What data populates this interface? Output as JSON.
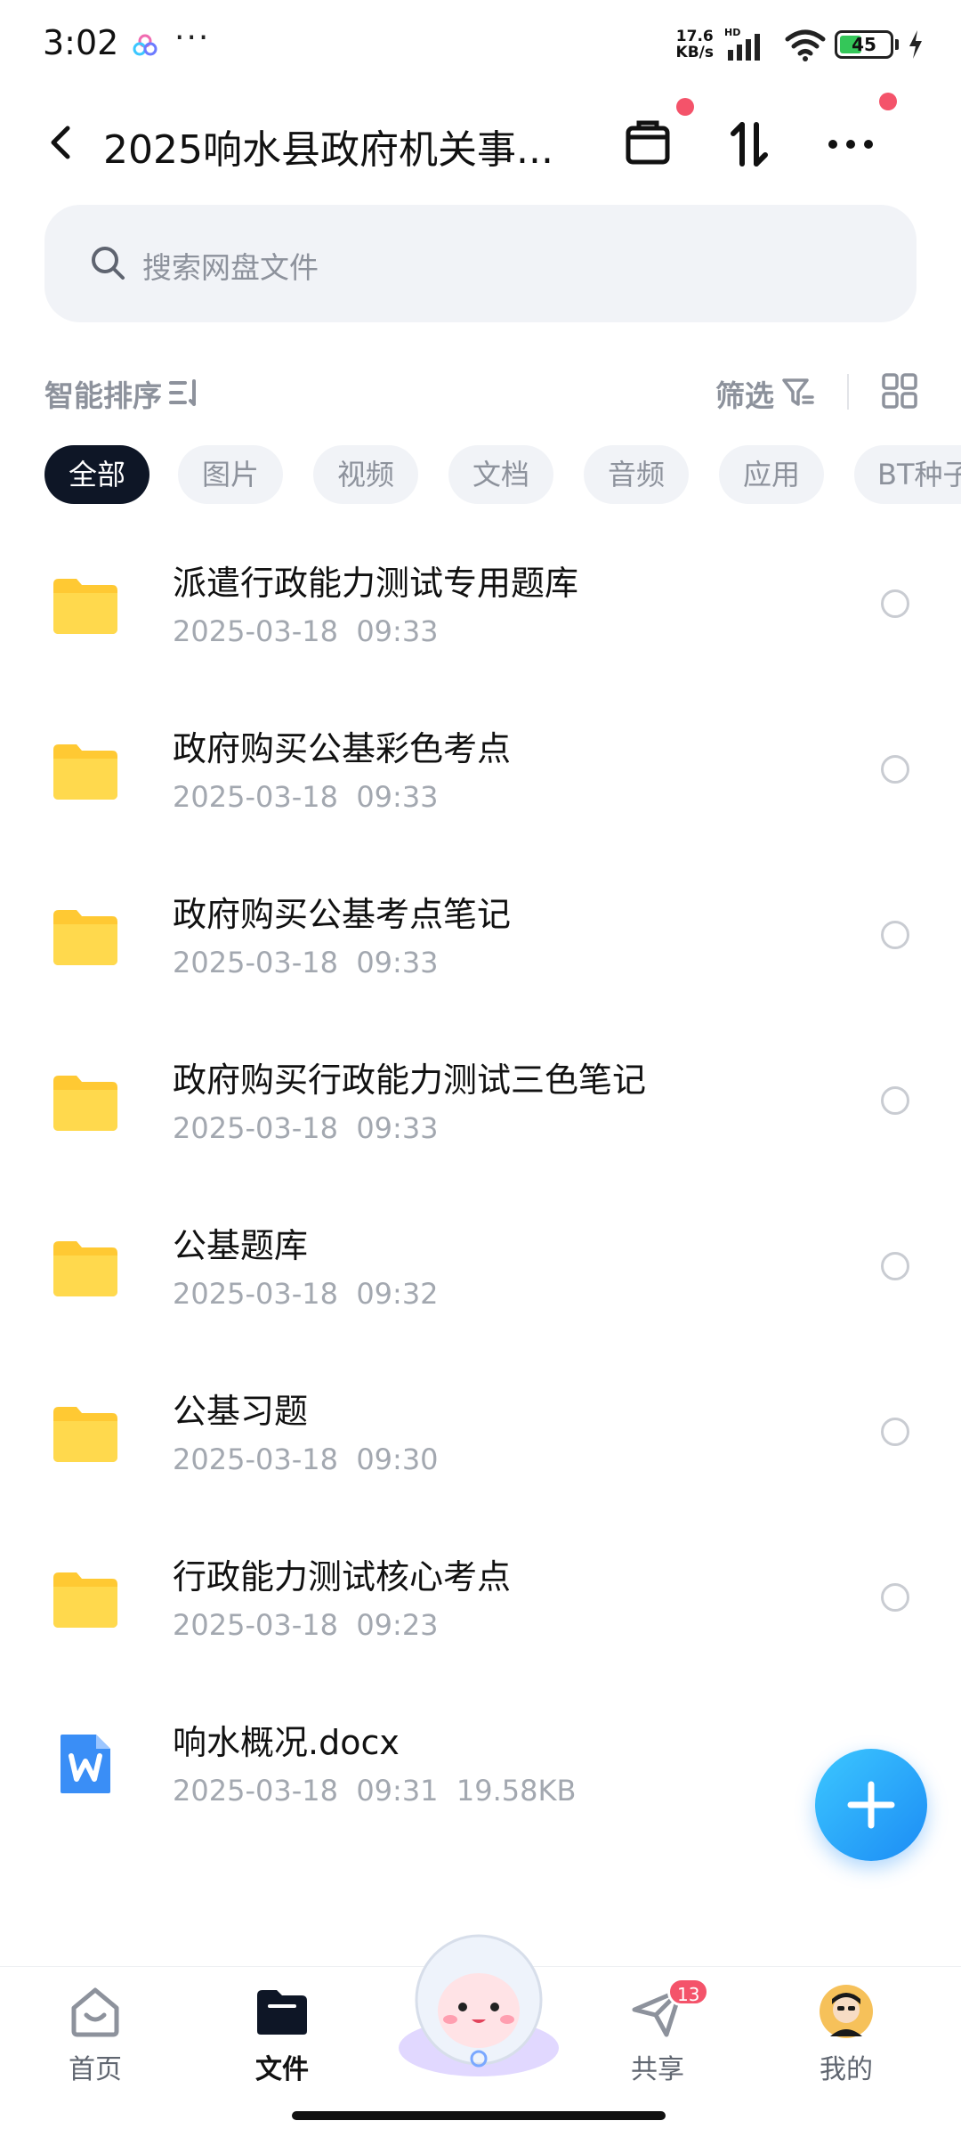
{
  "status_bar": {
    "time": "3:02",
    "more": "···",
    "net_speed_value": "17.6",
    "net_speed_unit": "KB/s",
    "network_label": "HD",
    "battery": "45",
    "battery_level": 0.45
  },
  "header": {
    "title": "2025响水县政府机关事...",
    "back_icon": "chevron-left-icon",
    "icons": [
      "clipboard-icon",
      "sort-arrows-icon",
      "more-icon"
    ],
    "accent_dot_color": "#f4536a"
  },
  "search": {
    "placeholder": "搜索网盘文件"
  },
  "toolbar": {
    "sort_label": "智能排序",
    "filter_label": "筛选"
  },
  "chips": [
    {
      "label": "全部",
      "active": true
    },
    {
      "label": "图片",
      "active": false
    },
    {
      "label": "视频",
      "active": false
    },
    {
      "label": "文档",
      "active": false
    },
    {
      "label": "音频",
      "active": false
    },
    {
      "label": "应用",
      "active": false
    },
    {
      "label": "BT种子",
      "active": false
    }
  ],
  "files": [
    {
      "name": "派遣行政能力测试专用题库",
      "date": "2025-03-18",
      "time": "09:33",
      "type": "folder"
    },
    {
      "name": "政府购买公基彩色考点",
      "date": "2025-03-18",
      "time": "09:33",
      "type": "folder"
    },
    {
      "name": "政府购买公基考点笔记",
      "date": "2025-03-18",
      "time": "09:33",
      "type": "folder"
    },
    {
      "name": "政府购买行政能力测试三色笔记",
      "date": "2025-03-18",
      "time": "09:33",
      "type": "folder"
    },
    {
      "name": "公基题库",
      "date": "2025-03-18",
      "time": "09:32",
      "type": "folder"
    },
    {
      "name": "公基习题",
      "date": "2025-03-18",
      "time": "09:30",
      "type": "folder"
    },
    {
      "name": "行政能力测试核心考点",
      "date": "2025-03-18",
      "time": "09:23",
      "type": "folder"
    },
    {
      "name": "响水概况.docx",
      "date": "2025-03-18",
      "time": "09:31",
      "size": "19.58KB",
      "type": "word"
    }
  ],
  "bottom_nav": [
    {
      "label": "首页",
      "icon": "home-icon",
      "active": false
    },
    {
      "label": "文件",
      "icon": "folder-icon",
      "active": true
    },
    {
      "label": "共享",
      "icon": "paper-plane-icon",
      "active": false,
      "badge": "13"
    },
    {
      "label": "我的",
      "icon": "avatar-icon",
      "active": false
    }
  ],
  "colors": {
    "accent": "#1c8cf5",
    "folder": "#ffd43b",
    "active_chip": "#0e1626",
    "badge": "#f4536a"
  }
}
